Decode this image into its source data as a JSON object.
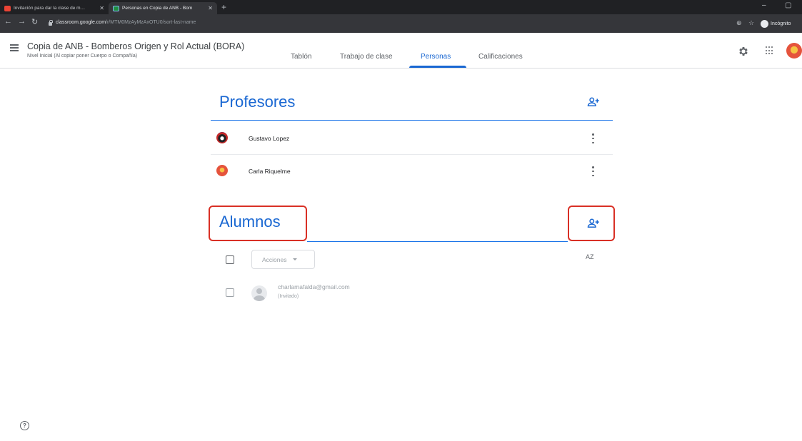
{
  "browser": {
    "tabs": [
      {
        "title": "Invitación para dar la clase de m…",
        "active": false
      },
      {
        "title": "Personas en Copia de ANB - Bom",
        "active": true
      }
    ],
    "url_host": "classroom.google.com",
    "url_path": "/r/MTM0MzAyMzAxOTU0/sort-last-name",
    "incognito_label": "Incógnito"
  },
  "header": {
    "class_title": "Copia de ANB - Bomberos Origen y Rol Actual (BORA)",
    "class_subtitle": "Nivel Inicial (Al copiar poner Cuerpo o Compañía)",
    "tabs": [
      {
        "label": "Tablón"
      },
      {
        "label": "Trabajo de clase"
      },
      {
        "label": "Personas",
        "active": true
      },
      {
        "label": "Calificaciones"
      }
    ]
  },
  "teachers": {
    "title": "Profesores",
    "list": [
      {
        "name": "Gustavo Lopez"
      },
      {
        "name": "Carla Riquelme"
      }
    ]
  },
  "students": {
    "title": "Alumnos",
    "actions_label": "Acciones",
    "sort_label": "AZ",
    "list": [
      {
        "email": "charlamafalda@gmail.com",
        "status": "(Invitado)"
      }
    ]
  },
  "colors": {
    "accent": "#1967d2",
    "highlight": "#d93025"
  }
}
